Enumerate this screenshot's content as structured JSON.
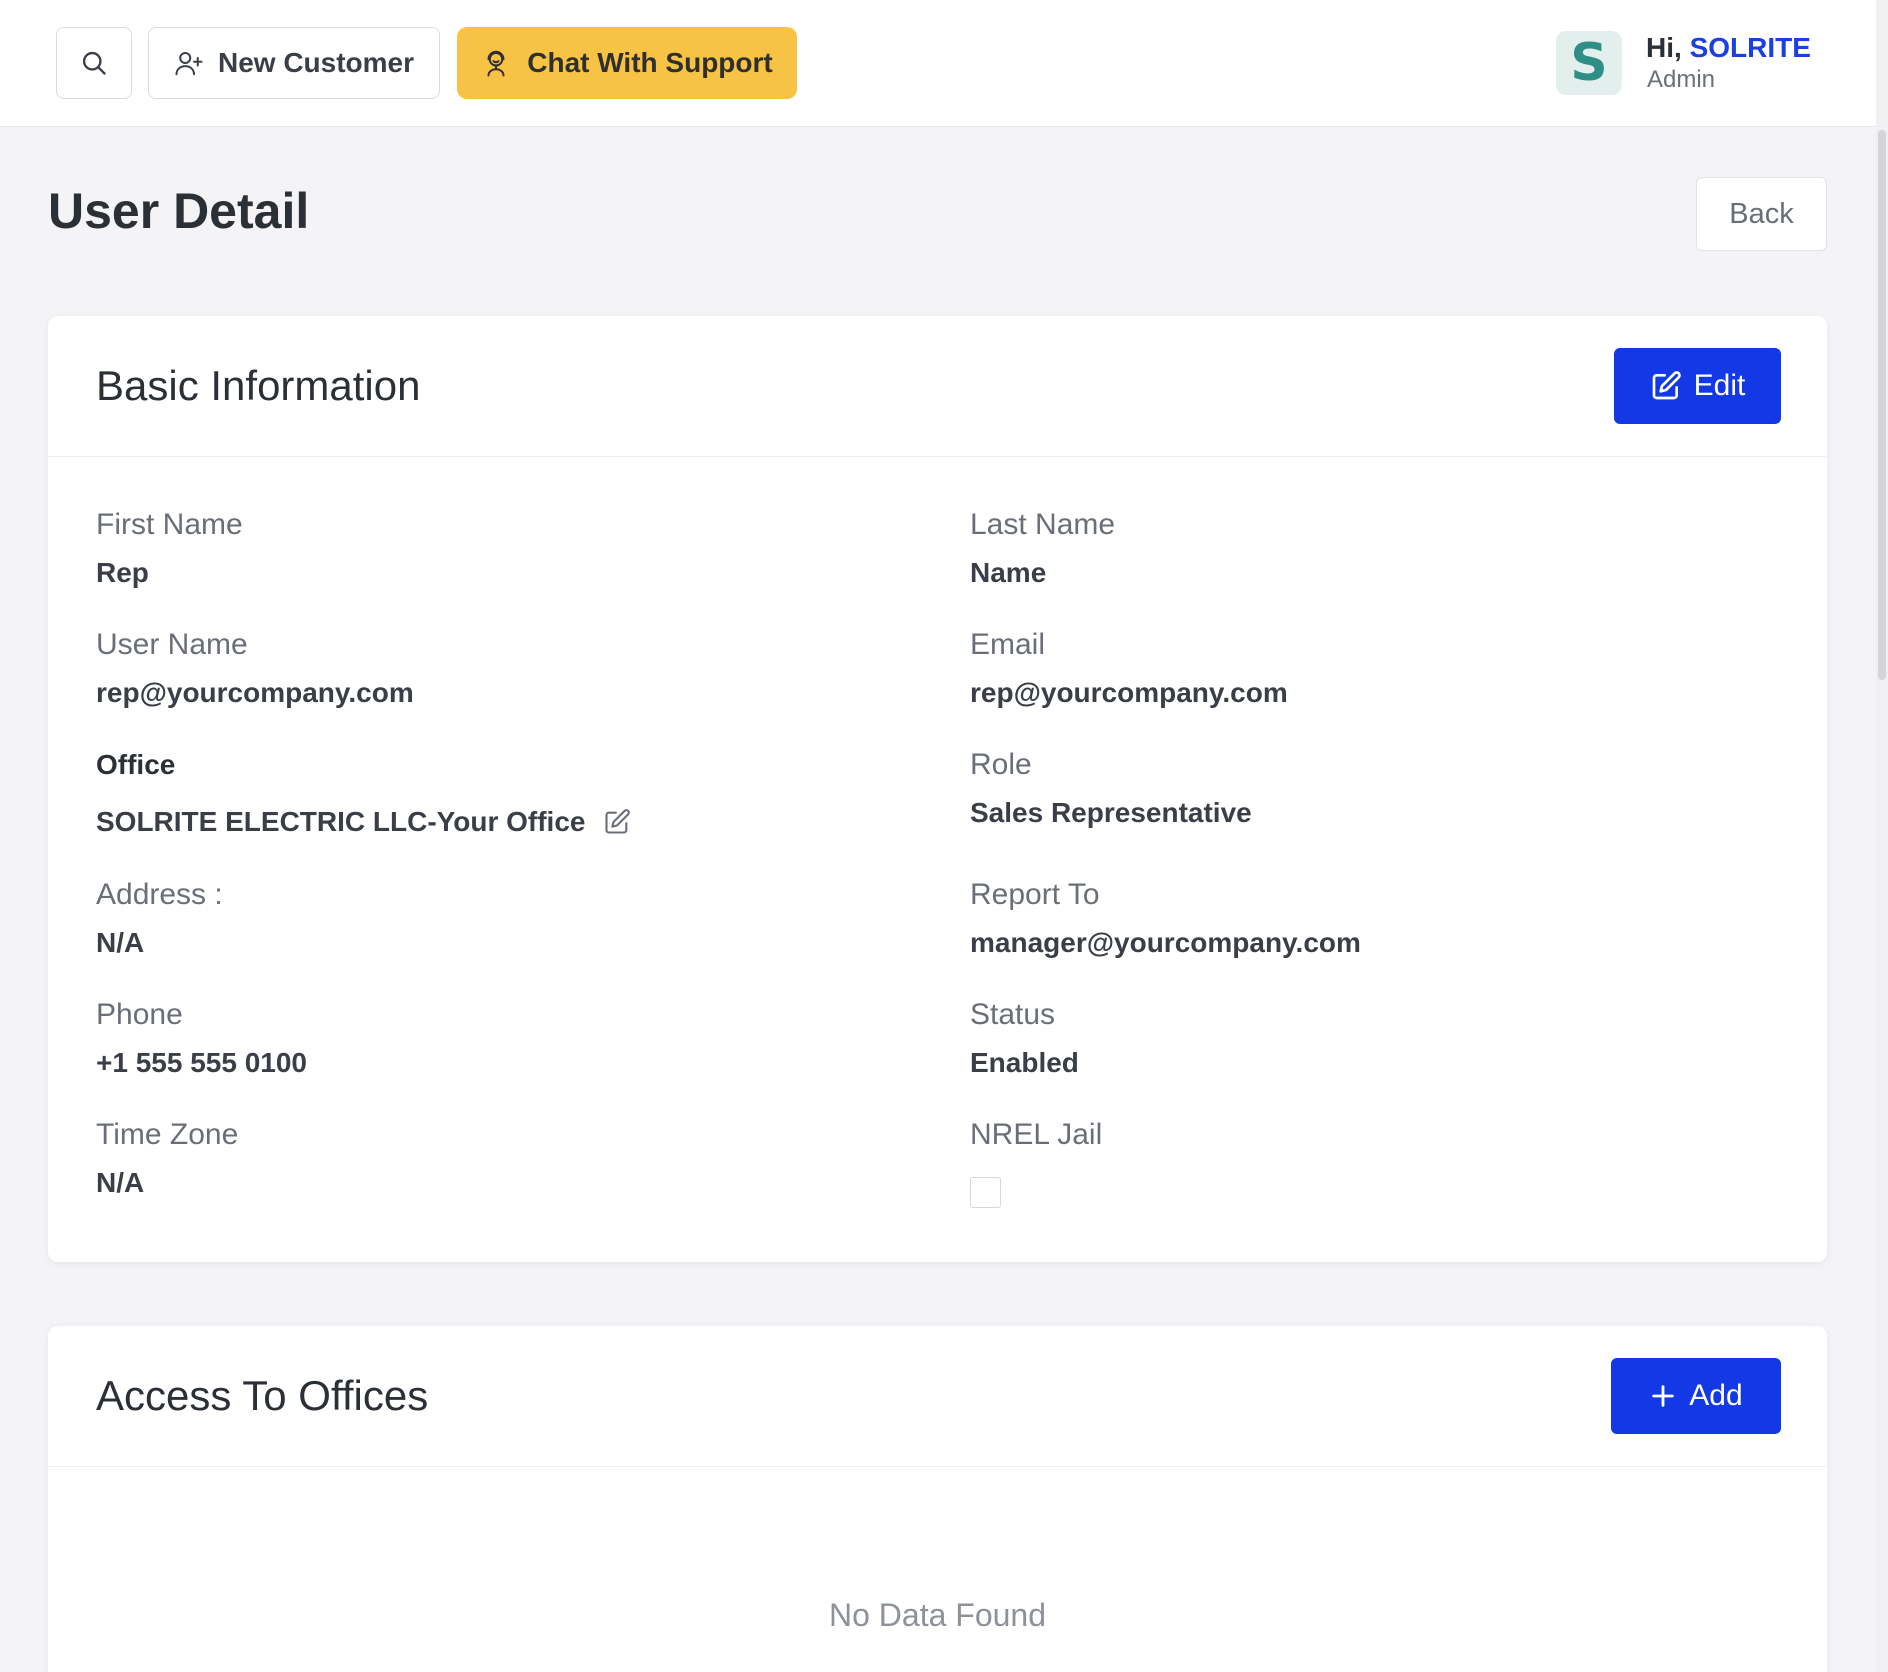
{
  "topbar": {
    "new_customer_label": "New Customer",
    "chat_support_label": "Chat With Support",
    "avatar_letter": "S",
    "greeting_prefix": "Hi, ",
    "greeting_name": "SOLRITE",
    "user_role": "Admin"
  },
  "page": {
    "title": "User Detail",
    "back_label": "Back"
  },
  "basic_info": {
    "title": "Basic Information",
    "edit_label": "Edit",
    "fields": {
      "first_name": {
        "label": "First Name",
        "value": "Rep"
      },
      "last_name": {
        "label": "Last Name",
        "value": "Name"
      },
      "user_name": {
        "label": "User Name",
        "value": "rep@yourcompany.com"
      },
      "email": {
        "label": "Email",
        "value": "rep@yourcompany.com"
      },
      "office": {
        "label": "Office",
        "value": "SOLRITE ELECTRIC LLC-Your Office"
      },
      "role": {
        "label": "Role",
        "value": "Sales Representative"
      },
      "address": {
        "label": "Address :",
        "value": "N/A"
      },
      "report_to": {
        "label": "Report To",
        "value": "manager@yourcompany.com"
      },
      "phone": {
        "label": "Phone",
        "value": "+1 555 555 0100"
      },
      "status": {
        "label": "Status",
        "value": "Enabled"
      },
      "time_zone": {
        "label": "Time Zone",
        "value": "N/A"
      },
      "nrel_jail": {
        "label": "NREL Jail",
        "checked": false
      }
    }
  },
  "access_offices": {
    "title": "Access To Offices",
    "add_label": "Add",
    "empty_text": "No Data Found"
  },
  "colors": {
    "primary": "#1338e6",
    "support_yellow": "#f6c344",
    "brand_blue": "#1b3fe0",
    "avatar_teal": "#2f8f86"
  },
  "icons": [
    "search-icon",
    "add-user-icon",
    "support-agent-icon",
    "edit-icon",
    "plus-icon",
    "edit-office-icon"
  ]
}
